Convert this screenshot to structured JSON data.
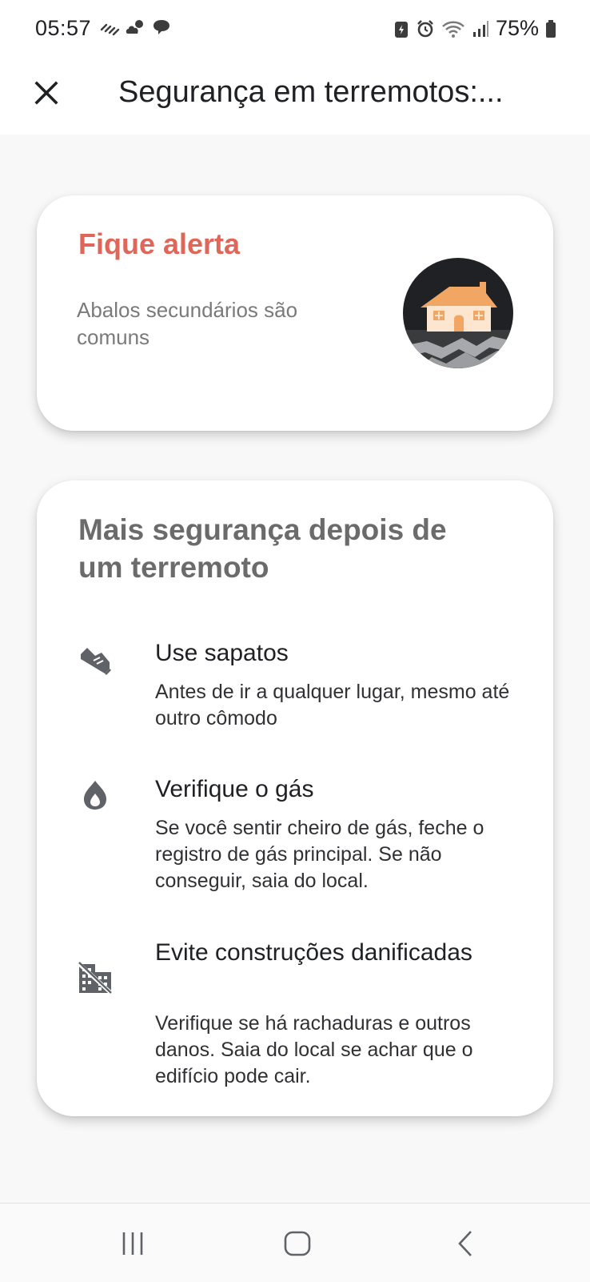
{
  "status_bar": {
    "time": "05:57",
    "battery": "75%",
    "icons": [
      "weather-warning-icon",
      "cloud-sun-icon",
      "chat-bubble-icon",
      "battery-saver-icon",
      "alarm-icon",
      "wifi-icon",
      "signal-icon",
      "battery-icon"
    ]
  },
  "app_bar": {
    "title": "Segurança em terremotos:...",
    "close_icon": "close-icon"
  },
  "alert_card": {
    "title": "Fique alerta",
    "description": "Abalos secundários são comuns",
    "image_icon": "house-earthquake-illustration",
    "title_color": "#e0665a"
  },
  "safety_card": {
    "heading": "Mais segurança depois de um terremoto",
    "tips": [
      {
        "icon": "shoe-icon",
        "title": "Use sapatos",
        "description": "Antes de ir a qualquer lugar, mesmo até outro cômodo"
      },
      {
        "icon": "gas-flame-icon",
        "title": "Verifique o gás",
        "description": "Se você sentir cheiro de gás, feche o registro de gás principal. Se não conseguir, saia do local."
      },
      {
        "icon": "damaged-building-icon",
        "title": "Evite construções danificadas",
        "description": "Verifique se há rachaduras e outros danos. Saia do local se achar que o edifício pode cair."
      }
    ]
  },
  "nav_bar": {
    "buttons": [
      "recent-apps-icon",
      "home-icon",
      "back-icon"
    ]
  },
  "colors": {
    "background": "#f8f8f8",
    "card": "#ffffff",
    "accent": "#e0665a",
    "heading_gray": "#6b6b6b"
  }
}
